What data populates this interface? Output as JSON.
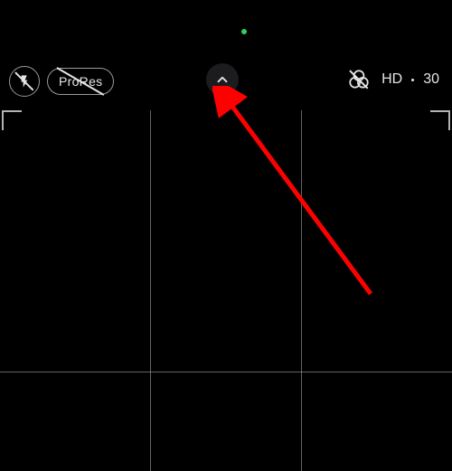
{
  "indicator": {
    "recording_dot_color": "#30d158"
  },
  "toolbar": {
    "flash_icon": "flash-off-icon",
    "prores_label": "ProRes",
    "chevron_icon": "chevron-up-icon",
    "effects_icon": "color-filters-off-icon",
    "resolution_label": "HD",
    "separator": "·",
    "fps_label": "30"
  },
  "annotation": {
    "arrow_color": "#ff0000"
  }
}
